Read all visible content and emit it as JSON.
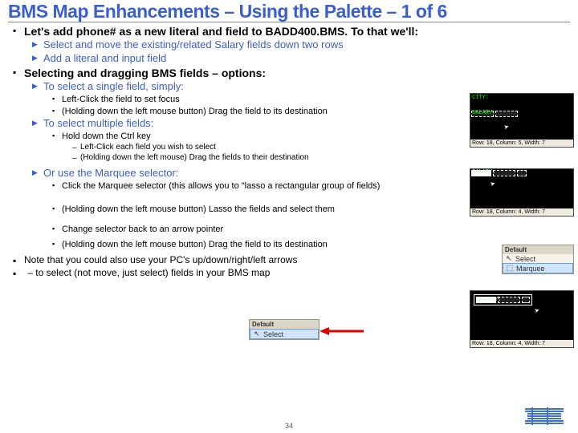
{
  "title": "BMS Map Enhancements – Using the Palette – 1 of 6",
  "b1_intro": "Let's add phone# as a new literal and field to BADD400.BMS.  To that we'll:",
  "b2_intro_a": "Select and move the existing/related Salary fields down two rows",
  "b2_intro_b": "Add a literal and input field",
  "b1_select": "Selecting and dragging BMS fields – options:",
  "b2_single": "To select a single field, simply:",
  "b3_single_a": "Left-Click the field to set focus",
  "b3_single_b": "(Holding down the left mouse button) Drag the field to its destination",
  "b2_multi": "To select multiple fields:",
  "b3_multi_a": "Hold down the Ctrl key",
  "b4_multi_a": "Left-Click each field you wish to select",
  "b4_multi_b": "(Holding down the left mouse) Drag the fields to their destination",
  "b2_marquee": "Or use the Marquee selector:",
  "b3_marquee_a": "Click the Marquee selector (this allows you to \"lasso a rectangular group of fields)",
  "b3_marquee_b": "(Holding down the left mouse button) Lasso the fields and select them",
  "b3_marquee_c": "Change selector back to an arrow pointer",
  "b3_marquee_d": "(Holding down the left mouse button) Drag the field to its destination",
  "footnote1": "Note that you could also use your PC's up/down/right/left arrows",
  "footnote2": "– to select (not move, just select) fields in your BMS map",
  "page_num": "34",
  "thumb1": {
    "city": "CITY:",
    "salary": "SALARY:",
    "status": "Row: 18, Column: 5, Width: 7"
  },
  "thumb2": {
    "salary": "SALARY:",
    "status": "Row: 18, Column: 4, Width: 7"
  },
  "palette1": {
    "hdr": "Default",
    "rows": [
      "Select",
      "Marquee"
    ]
  },
  "palette2": {
    "hdr": "Default",
    "rows": [
      "Select"
    ]
  },
  "thumb3": {
    "salary": "SALARY:",
    "status": "Row: 18, Column: 4, Width: 7"
  }
}
